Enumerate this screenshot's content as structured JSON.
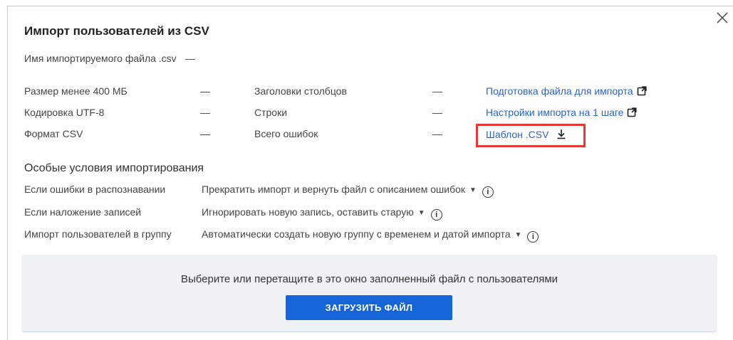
{
  "dialog": {
    "title": "Импорт пользователей из CSV",
    "filename_label": "Имя импортируемого файла .csv",
    "filename_value": "—"
  },
  "requirements": [
    {
      "label": "Размер менее 400 МБ",
      "value": "—"
    },
    {
      "label": "Кодировка UTF-8",
      "value": "—"
    },
    {
      "label": "Формат CSV",
      "value": "—"
    }
  ],
  "stats": [
    {
      "label": "Заголовки столбцов",
      "value": "—"
    },
    {
      "label": "Строки",
      "value": "—"
    },
    {
      "label": "Всего ошибок",
      "value": "—"
    }
  ],
  "links": {
    "prepare": "Подготовка файла для импорта",
    "settings": "Настройки импорта на 1 шаге",
    "template": "Шаблон .CSV"
  },
  "conditions": {
    "title": "Особые условия импортирования",
    "items": [
      {
        "label": "Если ошибки в распознавании",
        "value": "Прекратить импорт и вернуть файл с описанием ошибок"
      },
      {
        "label": "Если наложение записей",
        "value": "Игнорировать новую запись, оставить старую"
      },
      {
        "label": "Импорт пользователей в группу",
        "value": "Автоматически создать новую группу с временем и датой импорта"
      }
    ]
  },
  "dropzone": {
    "text": "Выберите или перетащите в это окно заполненный файл с пользователями",
    "button": "ЗАГРУЗИТЬ ФАЙЛ"
  },
  "colors": {
    "link": "#2a62c9",
    "primary_button": "#1565d8",
    "highlight": "#e53935",
    "dropzone_bg": "#eef1f6"
  },
  "icons": {
    "close": "close-icon",
    "external": "external-link-icon",
    "download": "download-icon",
    "info": "info-icon",
    "caret": "caret-down-icon"
  }
}
